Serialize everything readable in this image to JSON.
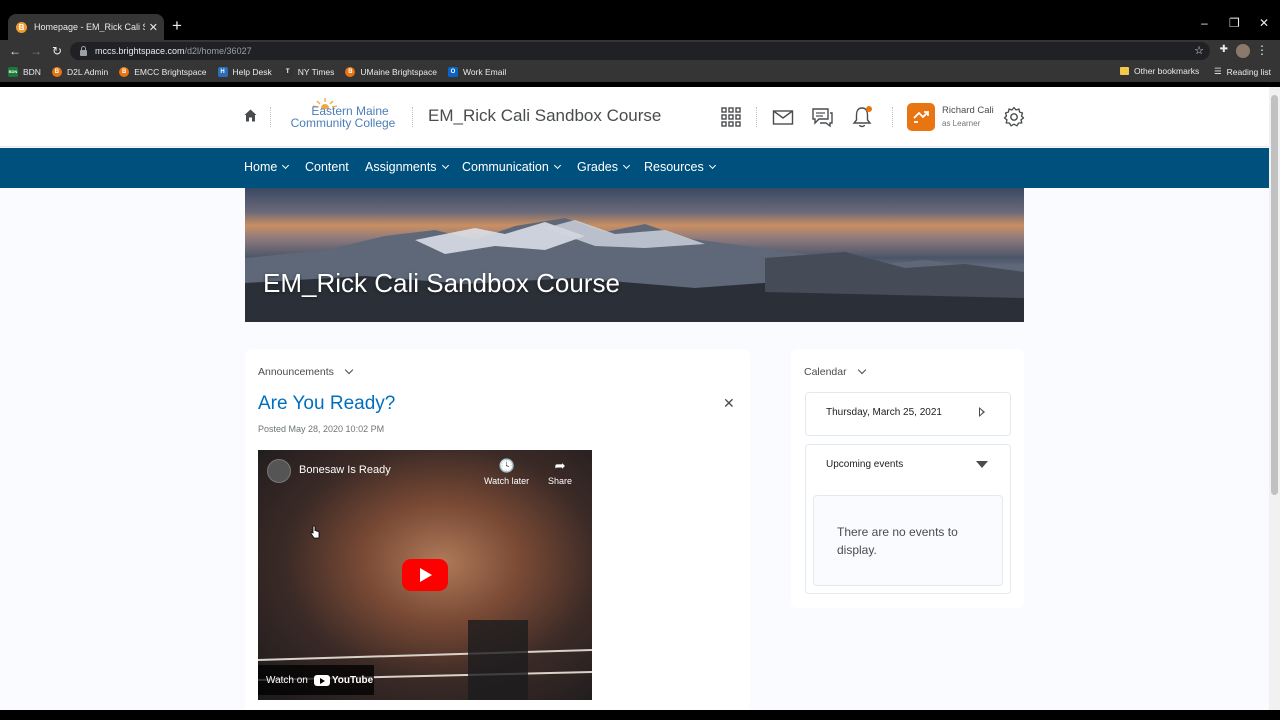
{
  "browser": {
    "tab_title": "Homepage - EM_Rick Cali Sandb",
    "tab_favicon": "B",
    "url_host": "mccs.brightspace.com",
    "url_path": "/d2l/home/36027",
    "bookmarks": [
      {
        "label": "BDN",
        "icon": "BDN",
        "color": "#1b7a3a"
      },
      {
        "label": "D2L Admin",
        "icon": "B",
        "color": "#e87511"
      },
      {
        "label": "EMCC Brightspace",
        "icon": "B",
        "color": "#e87511"
      },
      {
        "label": "Help Desk",
        "icon": "H",
        "color": "#2a6ebb"
      },
      {
        "label": "NY Times",
        "icon": "T",
        "color": "#333333"
      },
      {
        "label": "UMaine Brightspace",
        "icon": "B",
        "color": "#e87511"
      },
      {
        "label": "Work Email",
        "icon": "O",
        "color": "#0a64c8"
      }
    ],
    "other_bookmarks": "Other bookmarks",
    "reading_list": "Reading list"
  },
  "header": {
    "logo_line1": "Eastern Maine",
    "logo_line2": "Community College",
    "course_title": "EM_Rick Cali Sandbox Course",
    "user_name": "Richard Cali",
    "user_role": "as Learner"
  },
  "nav": {
    "items": [
      {
        "label": "Home",
        "dropdown": true
      },
      {
        "label": "Content",
        "dropdown": false
      },
      {
        "label": "Assignments",
        "dropdown": true
      },
      {
        "label": "Communication",
        "dropdown": true
      },
      {
        "label": "Grades",
        "dropdown": true
      },
      {
        "label": "Resources",
        "dropdown": true
      }
    ]
  },
  "banner": {
    "title": "EM_Rick Cali Sandbox Course"
  },
  "announcements": {
    "widget_title": "Announcements",
    "title": "Are You Ready?",
    "posted": "Posted May 28, 2020 10:02 PM",
    "video": {
      "title": "Bonesaw Is Ready",
      "watch_later": "Watch later",
      "share": "Share",
      "watch_on": "Watch on",
      "youtube": "YouTube"
    }
  },
  "calendar": {
    "widget_title": "Calendar",
    "date": "Thursday, March 25, 2021",
    "upcoming": "Upcoming events",
    "no_events": "There are no events to display."
  },
  "colors": {
    "nav_bg": "#00507d",
    "accent_orange": "#e87511",
    "link_blue": "#006fbf"
  }
}
